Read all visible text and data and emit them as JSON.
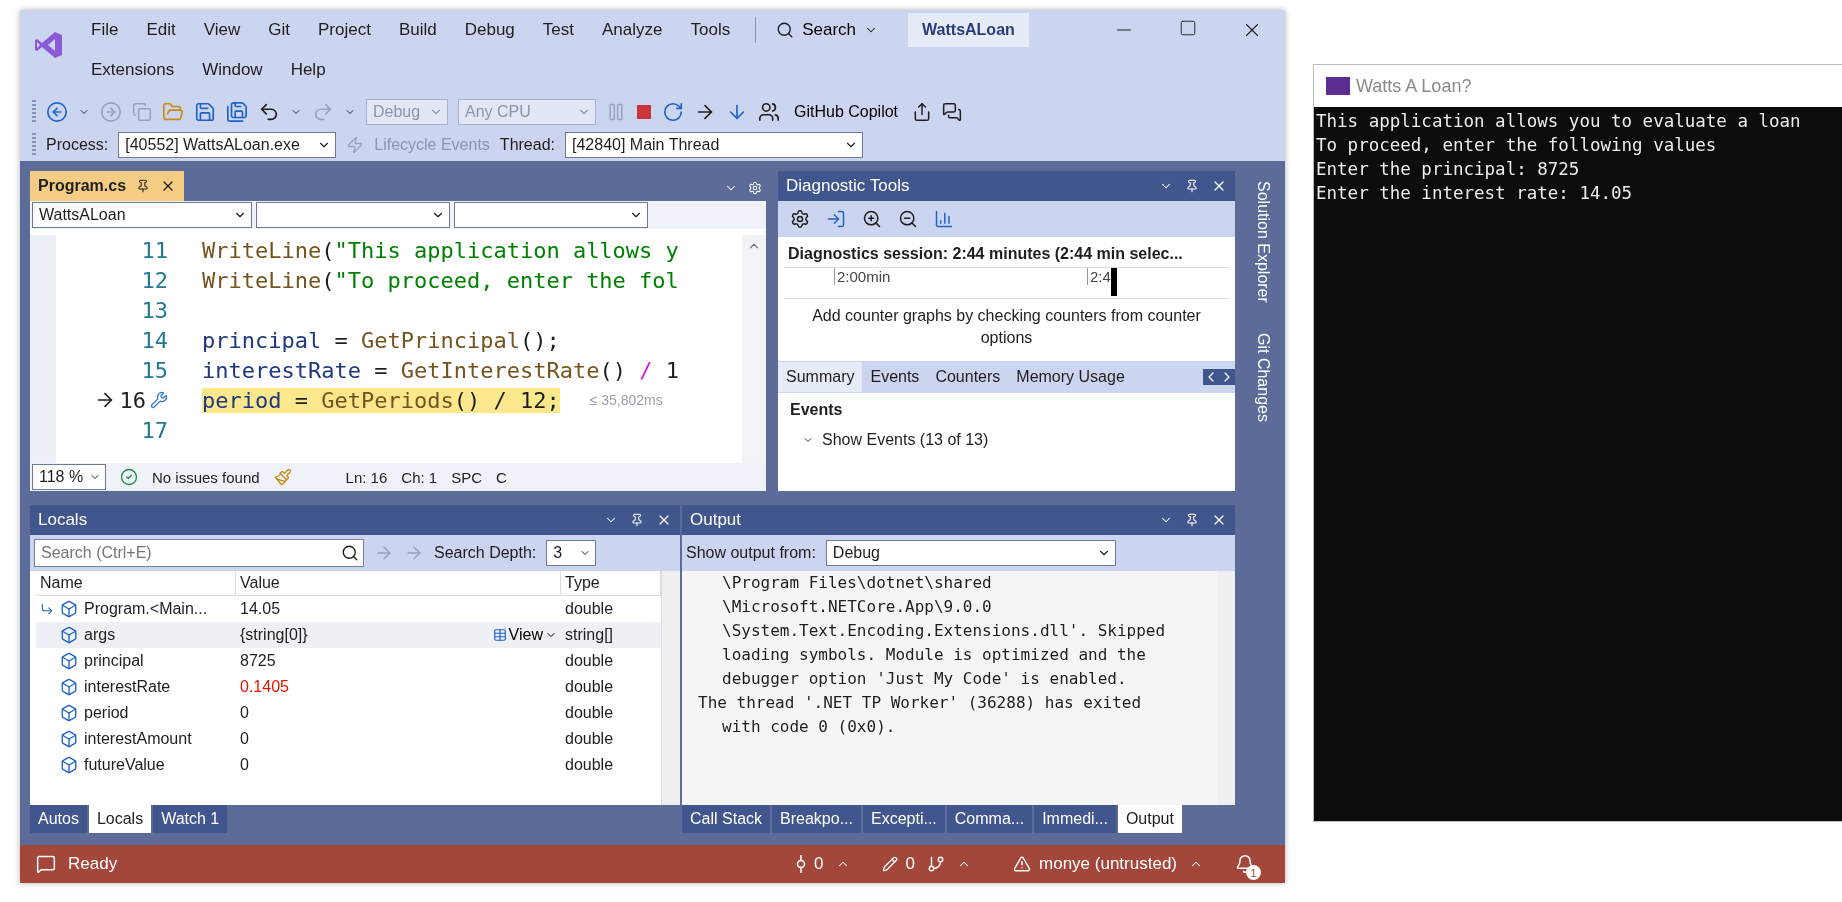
{
  "ide": {
    "menu_rows": [
      [
        "File",
        "Edit",
        "View",
        "Git",
        "Project",
        "Build",
        "Debug",
        "Test",
        "Analyze",
        "Tools"
      ],
      [
        "Extensions",
        "Window",
        "Help"
      ]
    ],
    "search": "Search",
    "solution": "WattsALoan",
    "toolbar": {
      "configuration": "Debug",
      "platform": "Any CPU",
      "copilot": "GitHub Copilot"
    },
    "debug_location": {
      "process_label": "Process:",
      "process": "[40552] WattsALoan.exe",
      "lifecycle": "Lifecycle Events",
      "thread_label": "Thread:",
      "thread": "[42840] Main Thread"
    },
    "editor": {
      "tabs": [
        {
          "title": "Program.cs",
          "selected": true
        }
      ],
      "project": "WattsALoan",
      "lines": [
        {
          "number": "11",
          "current": false,
          "tokens": [
            {
              "text": "WriteLine",
              "kind": "method"
            },
            {
              "text": "(",
              "kind": "plain"
            },
            {
              "text": "\"This application allows y",
              "kind": "string"
            }
          ]
        },
        {
          "number": "12",
          "current": false,
          "tokens": [
            {
              "text": "WriteLine",
              "kind": "method"
            },
            {
              "text": "(",
              "kind": "plain"
            },
            {
              "text": "\"To proceed, enter the fol",
              "kind": "string"
            }
          ]
        },
        {
          "number": "13",
          "current": false
        },
        {
          "number": "14",
          "current": false,
          "tokens": [
            {
              "text": "principal",
              "kind": "variable"
            },
            {
              "text": " = ",
              "kind": "plain"
            },
            {
              "text": "GetPrincipal",
              "kind": "method"
            },
            {
              "text": "();",
              "kind": "plain"
            }
          ]
        },
        {
          "number": "15",
          "current": false,
          "tokens": [
            {
              "text": "interestRate",
              "kind": "variable"
            },
            {
              "text": " = ",
              "kind": "plain"
            },
            {
              "text": "GetInterestRate",
              "kind": "method"
            },
            {
              "text": "() ",
              "kind": "plain"
            },
            {
              "text": "/",
              "kind": "operator"
            },
            {
              "text": " 1",
              "kind": "plain"
            }
          ]
        },
        {
          "number": "16",
          "current": true,
          "elapsed": "≤ 35,802ms",
          "tokens": [
            {
              "text": "period",
              "kind": "variable"
            },
            {
              "text": " = ",
              "kind": "plain"
            },
            {
              "text": "GetPeriods",
              "kind": "method"
            },
            {
              "text": "() / 12;",
              "kind": "plain"
            }
          ]
        },
        {
          "number": "17",
          "current": false
        }
      ],
      "status": {
        "zoom": "118 %",
        "issues": "No issues found",
        "line": "Ln: 16",
        "column": "Ch: 1",
        "whitespace": "SPC",
        "line_ending": "C"
      }
    },
    "diagnostics": {
      "title": "Diagnostic Tools",
      "session": "Diagnostics session: 2:44 minutes (2:44 min selec...",
      "timeline_labels": [
        "2:00min",
        "2:4"
      ],
      "message": "Add counter graphs by checking counters from counter options",
      "tabs": [
        {
          "label": "Summary",
          "selected": true
        },
        {
          "label": "Events",
          "selected": false
        },
        {
          "label": "Counters",
          "selected": false
        },
        {
          "label": "Memory Usage",
          "selected": false
        }
      ],
      "events_heading": "Events",
      "show_events": "Show Events (13 of 13)"
    },
    "side_tabs": [
      "Solution Explorer",
      "Git Changes"
    ],
    "locals": {
      "title": "Locals",
      "search_placeholder": "Search (Ctrl+E)",
      "depth_label": "Search Depth:",
      "depth": "3",
      "columns": [
        "Name",
        "Value",
        "Type"
      ],
      "rows": [
        {
          "kind": "return",
          "name": "Program.<Main...",
          "value": "14.05",
          "type": "double",
          "changed": false,
          "selected": false
        },
        {
          "kind": "variable",
          "name": "args",
          "value": "{string[0]}",
          "view": "View",
          "type": "string[]",
          "changed": false,
          "selected": true
        },
        {
          "kind": "variable",
          "name": "principal",
          "value": "8725",
          "type": "double",
          "changed": false,
          "selected": false
        },
        {
          "kind": "variable",
          "name": "interestRate",
          "value": "0.1405",
          "type": "double",
          "changed": true,
          "selected": false
        },
        {
          "kind": "variable",
          "name": "period",
          "value": "0",
          "type": "double",
          "changed": false,
          "selected": false
        },
        {
          "kind": "variable",
          "name": "interestAmount",
          "value": "0",
          "type": "double",
          "changed": false,
          "selected": false
        },
        {
          "kind": "variable",
          "name": "futureValue",
          "value": "0",
          "type": "double",
          "changed": false,
          "selected": false
        }
      ],
      "tabs": [
        {
          "label": "Autos",
          "selected": false
        },
        {
          "label": "Locals",
          "selected": true
        },
        {
          "label": "Watch 1",
          "selected": false
        }
      ]
    },
    "output": {
      "title": "Output",
      "source_label": "Show output from:",
      "source": "Debug",
      "lines": [
        {
          "kind": "continuation",
          "text": "\\Program Files\\dotnet\\shared"
        },
        {
          "kind": "continuation",
          "text": "\\Microsoft.NETCore.App\\9.0.0"
        },
        {
          "kind": "continuation",
          "text": "\\System.Text.Encoding.Extensions.dll'. Skipped"
        },
        {
          "kind": "continuation",
          "text": "loading symbols. Module is optimized and the"
        },
        {
          "kind": "continuation",
          "text": "debugger option 'Just My Code' is enabled."
        },
        {
          "kind": "start",
          "text": "The thread '.NET TP Worker' (36288) has exited"
        },
        {
          "kind": "continuation",
          "text": "with code 0 (0x0)."
        }
      ],
      "tabs": [
        {
          "label": "Call Stack",
          "selected": false
        },
        {
          "label": "Breakpo...",
          "selected": false
        },
        {
          "label": "Excepti...",
          "selected": false
        },
        {
          "label": "Comma...",
          "selected": false
        },
        {
          "label": "Immedi...",
          "selected": false
        },
        {
          "label": "Output",
          "selected": true
        }
      ]
    },
    "status_bar": {
      "message": "Ready",
      "commits": "0",
      "changes": "0",
      "account": "monye (untrusted)",
      "notifications": "1"
    }
  },
  "console": {
    "title": "Watts A Loan?",
    "lines": [
      "This application allows you to evaluate a loan",
      "To proceed, enter the following values",
      "Enter the principal: 8725",
      "Enter the interest rate: 14.05"
    ]
  }
}
